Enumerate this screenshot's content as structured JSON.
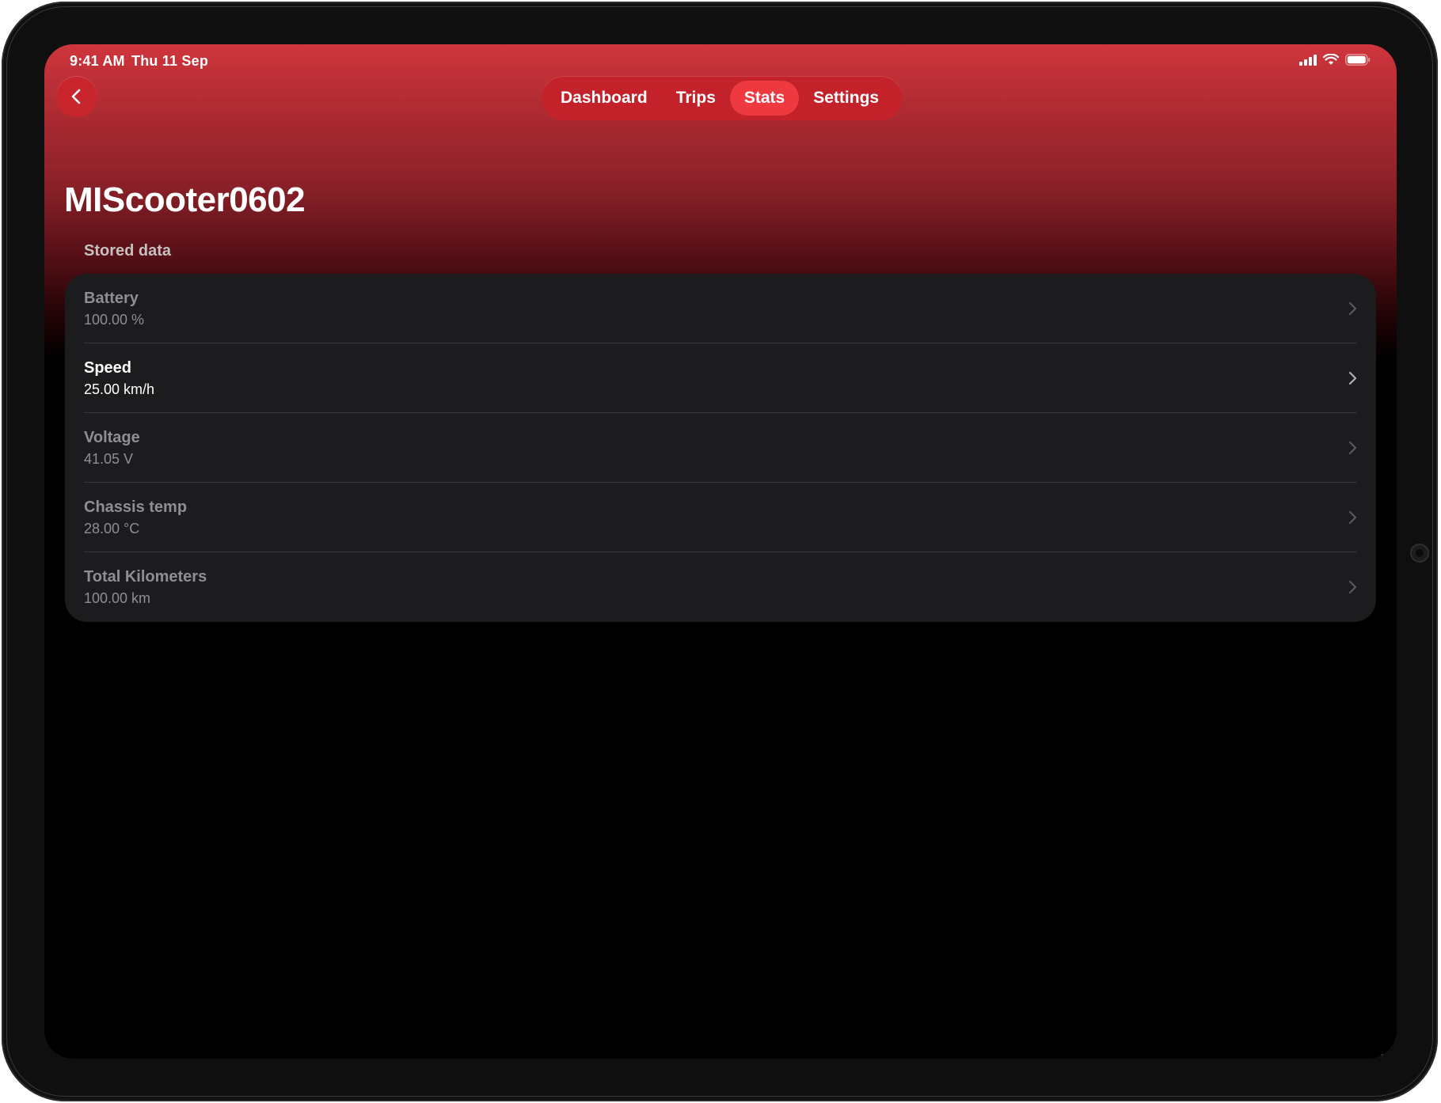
{
  "status_bar": {
    "time": "9:41 AM",
    "date": "Thu 11 Sep"
  },
  "nav": {
    "back_icon": "chevron-left-icon",
    "tabs": [
      {
        "label": "Dashboard",
        "active": false
      },
      {
        "label": "Trips",
        "active": false
      },
      {
        "label": "Stats",
        "active": true
      },
      {
        "label": "Settings",
        "active": false
      }
    ]
  },
  "page": {
    "title": "MIScooter0602",
    "section_header": "Stored data"
  },
  "stats": {
    "items": [
      {
        "label": "Battery",
        "value": "100.00 %",
        "highlighted": false
      },
      {
        "label": "Speed",
        "value": "25.00 km/h",
        "highlighted": true
      },
      {
        "label": "Voltage",
        "value": "41.05 V",
        "highlighted": false
      },
      {
        "label": "Chassis temp",
        "value": "28.00 °C",
        "highlighted": false
      },
      {
        "label": "Total Kilometers",
        "value": "100.00 km",
        "highlighted": false
      }
    ]
  },
  "colors": {
    "accent": "#c4222a",
    "active_tab": "#ef3940",
    "card": "#1c1c1e",
    "background": "#000000"
  }
}
